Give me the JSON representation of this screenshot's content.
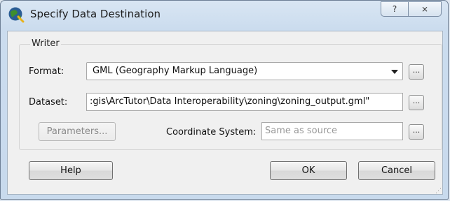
{
  "window": {
    "title": "Specify Data Destination",
    "help_glyph": "?",
    "close_glyph": "⨯"
  },
  "icons": {
    "app": "qgis-globe-icon",
    "help": "question-mark-icon",
    "close": "close-icon",
    "dropdown": "chevron-down-icon"
  },
  "writer": {
    "group_title": "Writer",
    "format_label": "Format:",
    "format_value": "GML (Geography Markup Language)",
    "dataset_label": "Dataset:",
    "dataset_value": ":gis\\ArcTutor\\Data Interoperability\\zoning\\zoning_output.gml\"",
    "browse_label": "...",
    "parameters_label": "Parameters...",
    "coord_label": "Coordinate System:",
    "coord_placeholder": "Same as source"
  },
  "buttons": {
    "help": "Help",
    "ok": "OK",
    "cancel": "Cancel"
  },
  "colors": {
    "title_bar": "#cbdcee",
    "client_bg": "#f0f0f0",
    "icon_green": "#3e8e2e",
    "icon_blue": "#2a5d95"
  }
}
